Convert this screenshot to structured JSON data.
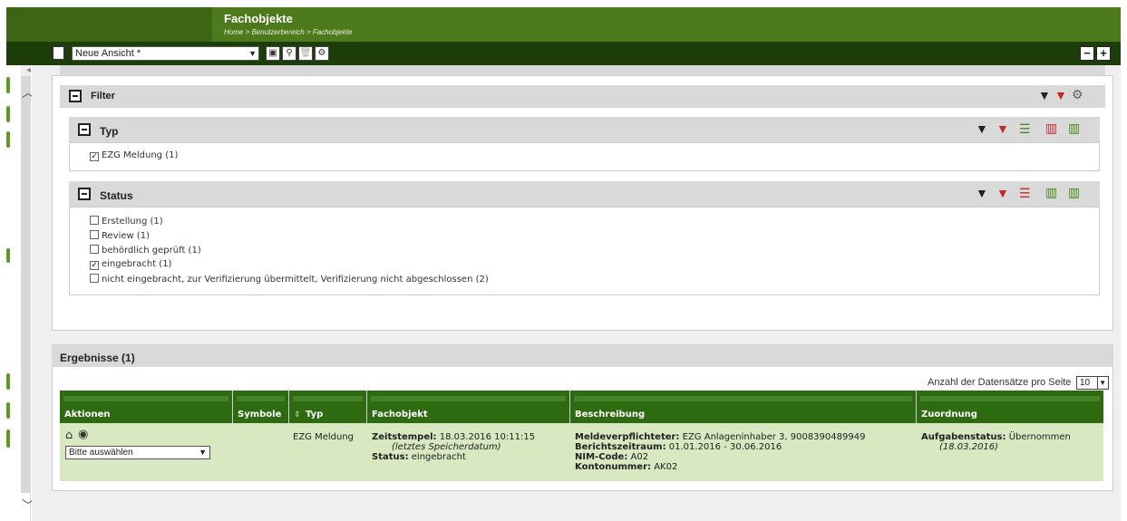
{
  "header": {
    "title": "Fachobjekte",
    "breadcrumb": "Home > Benutzerbereich > Fachobjekte"
  },
  "toolbar": {
    "view_name": "Neue Ansicht *"
  },
  "filter": {
    "title": "Filter",
    "typ": {
      "title": "Typ",
      "options": [
        {
          "label": "EZG Meldung (1)",
          "checked": true
        }
      ]
    },
    "status": {
      "title": "Status",
      "options": [
        {
          "label": "Erstellung (1)",
          "checked": false
        },
        {
          "label": "Review (1)",
          "checked": false
        },
        {
          "label": "behördlich geprüft (1)",
          "checked": false
        },
        {
          "label": "eingebracht (1)",
          "checked": true
        },
        {
          "label": "nicht eingebracht, zur Verifizierung übermittelt, Verifizierung nicht abgeschlossen (2)",
          "checked": false
        }
      ]
    }
  },
  "results": {
    "title": "Ergebnisse (1)",
    "per_page_label": "Anzahl der Datensätze pro Seite",
    "per_page_value": "10",
    "columns": [
      "Aktionen",
      "Symbole",
      "Typ",
      "Fachobjekt",
      "Beschreibung",
      "Zuordnung"
    ],
    "row": {
      "action_select": "Bitte auswählen",
      "typ": "EZG Meldung",
      "zeitstempel_label": "Zeitstempel:",
      "zeitstempel_value": "18.03.2016 10:11:15",
      "zeitstempel_note": "(letztes Speicherdatum)",
      "status_label": "Status:",
      "status_value": "eingebracht",
      "meldeverpflichteter_label": "Meldeverpflichteter:",
      "meldeverpflichteter_value": "EZG Anlageninhaber 3, 9008390489949",
      "berichtszeitraum_label": "Berichtszeitraum:",
      "berichtszeitraum_value": "01.01.2016 - 30.06.2016",
      "nim_label": "NIM-Code:",
      "nim_value": "A02",
      "konto_label": "Kontonummer:",
      "konto_value": "AK02",
      "aufgabe_label": "Aufgabenstatus:",
      "aufgabe_value": "Übernommen",
      "aufgabe_date": "(18.03.2016)"
    }
  },
  "colors": {
    "header": "#4d7a1c",
    "toolbar": "#1d3d0a",
    "table_header": "#2e6b10",
    "row_bg": "#d8e8c0"
  }
}
